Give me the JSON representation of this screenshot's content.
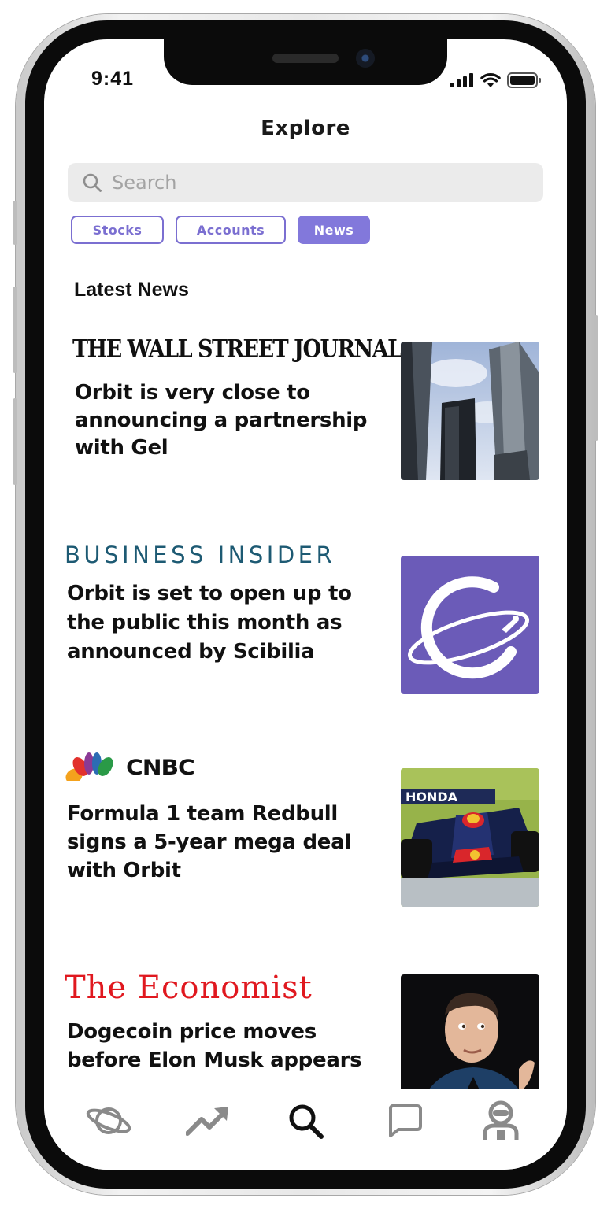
{
  "status_bar": {
    "time": "9:41"
  },
  "header": {
    "title": "Explore"
  },
  "search": {
    "placeholder": "Search"
  },
  "filters": [
    {
      "label": "Stocks",
      "active": false
    },
    {
      "label": "Accounts",
      "active": false
    },
    {
      "label": "News",
      "active": true
    }
  ],
  "section": {
    "title": "Latest News"
  },
  "news": [
    {
      "source": "THE WALL STREET JOURNAL.",
      "headline_lines": [
        "Orbit is very close to",
        "announcing a partnership",
        "with Gel"
      ],
      "image": "skyscrapers-photo"
    },
    {
      "source": "BUSINESS INSIDER",
      "headline_lines": [
        "Orbit is set to open up to",
        "the public this month as",
        "announced by Scibilia"
      ],
      "image": "orbit-logo"
    },
    {
      "source": "CNBC",
      "headline_lines": [
        "Formula 1 team Redbull",
        "signs a 5-year mega deal",
        "with Orbit"
      ],
      "image": "f1-car-photo",
      "image_text": "HONDA"
    },
    {
      "source": "The Economist",
      "headline_lines": [
        "Dogecoin price moves",
        "before Elon Musk appears"
      ],
      "image": "portrait-photo"
    }
  ],
  "tabbar": {
    "items": [
      {
        "icon": "planet-icon",
        "active": false
      },
      {
        "icon": "trending-icon",
        "active": false
      },
      {
        "icon": "search-icon",
        "active": true
      },
      {
        "icon": "chat-icon",
        "active": false
      },
      {
        "icon": "profile-icon",
        "active": false
      }
    ]
  },
  "colors": {
    "accent": "#8278db",
    "text": "#111111",
    "inactive_icon": "#8a8a8a",
    "search_bg": "#ebebeb"
  }
}
